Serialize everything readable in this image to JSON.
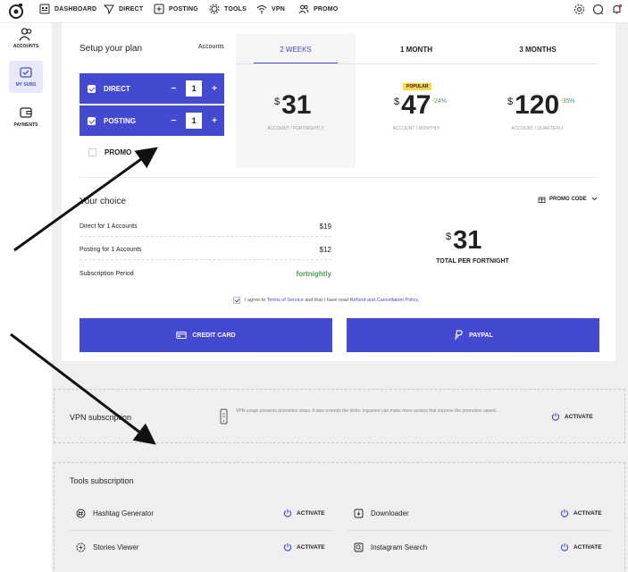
{
  "nav": {
    "items": [
      "DASHBOARD",
      "DIRECT",
      "POSTING",
      "TOOLS",
      "VPN",
      "PROMO"
    ]
  },
  "sidebar": {
    "items": [
      {
        "label": "ACCOUNTS",
        "icon": "users-icon"
      },
      {
        "label": "MY SUBS",
        "icon": "subscriptions-icon"
      },
      {
        "label": "PAYMENTS",
        "icon": "wallet-icon"
      }
    ]
  },
  "plan": {
    "setup_title": "Setup your plan",
    "accounts_label": "Accounts",
    "options": [
      {
        "label": "DIRECT",
        "qty": "1",
        "minus": "−",
        "plus": "+"
      },
      {
        "label": "POSTING",
        "qty": "1",
        "minus": "−",
        "plus": "+"
      }
    ],
    "promo_label": "PROMO",
    "periods": [
      {
        "label": "2 WEEKS",
        "currency": "$",
        "amount": "31",
        "discount": "",
        "sub": "ACCOUNT / FORTNIGHTLY"
      },
      {
        "label": "1 MONTH",
        "currency": "$",
        "amount": "47",
        "discount": "-24%",
        "sub": "ACCOUNT / MONTHLY",
        "badge": "POPULAR"
      },
      {
        "label": "3 MONTHS",
        "currency": "$",
        "amount": "120",
        "discount": "-35%",
        "sub": "ACCOUNT / QUARTERLY"
      }
    ]
  },
  "choice": {
    "title": "Your choice",
    "promo_code": "PROMO CODE",
    "rows": [
      {
        "label": "Direct for  1  Accounts",
        "value": "$19"
      },
      {
        "label": "Posting for  1  Accounts",
        "value": "$12"
      },
      {
        "label": "Subscription Period",
        "value": "fortnightly"
      }
    ],
    "total_currency": "$",
    "total_amount": "31",
    "total_label": "TOTAL PER FORTNIGHT"
  },
  "agree": {
    "prefix": "I agree to",
    "terms": "Terms of Service",
    "middle": "and that I have read",
    "policy": "Refund and Cancellation Policy",
    "suffix": "."
  },
  "payment": {
    "card_label": "CREDIT CARD",
    "paypal_label": "PAYPAL"
  },
  "vpn": {
    "title": "VPN subscription",
    "description": "VPN usage prevents promotion stops. It also extends the limits: Ingramer can make more actions that improve the promotion speed.",
    "activate": "ACTIVATE"
  },
  "tools": {
    "title": "Tools subscription",
    "activate": "ACTIVATE",
    "items": [
      {
        "label": "Hashtag Generator",
        "icon": "hashtag-icon"
      },
      {
        "label": "Downloader",
        "icon": "download-icon"
      },
      {
        "label": "Stories Viewer",
        "icon": "stories-icon"
      },
      {
        "label": "Instagram Search",
        "icon": "search-icon"
      }
    ]
  },
  "colors": {
    "accent": "#4349d1",
    "green": "#4a9a55",
    "badge": "#ffd64a"
  }
}
